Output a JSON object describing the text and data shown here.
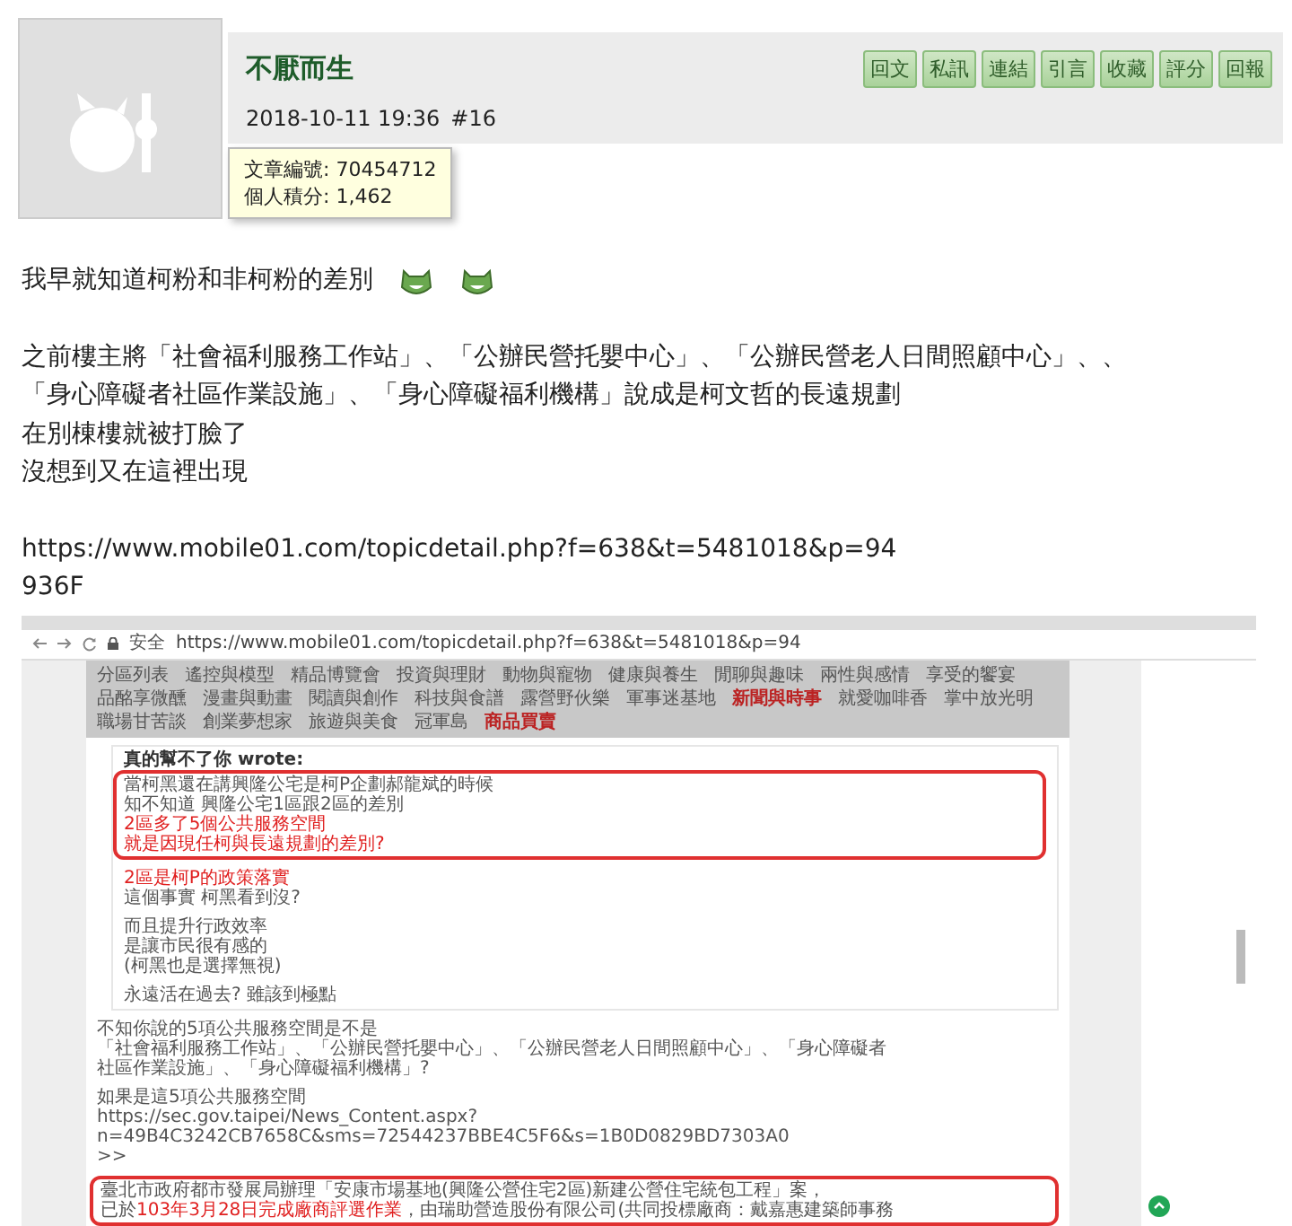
{
  "post": {
    "author": "不厭而生",
    "date": "2018-10-11 19:36",
    "floor": "#16",
    "buttons": [
      "回文",
      "私訊",
      "連結",
      "引言",
      "收藏",
      "評分",
      "回報"
    ],
    "tooltip": [
      {
        "label": "文章編號:",
        "value": "70454712"
      },
      {
        "label": "個人積分:",
        "value": "1,462"
      }
    ]
  },
  "body": [
    {
      "kind": "text",
      "lines": [
        "我早就知道柯粉和非柯粉的差別"
      ],
      "emoticons": true
    },
    {
      "kind": "text",
      "lines": [
        "之前樓主將「社會福利服務工作站」、「公辦民營托嬰中心」、「公辦民營老人日間照顧中心」、、",
        "「身心障礙者社區作業設施」、「身心障礙福利機構」說成是柯文哲的長遠規劃",
        "在別棟樓就被打臉了",
        "沒想到又在這裡出現"
      ],
      "emoticons": false
    },
    {
      "kind": "text",
      "lines": [
        "https://www.mobile01.com/topicdetail.php?f=638&t=5481018&p=94",
        "936F"
      ],
      "emoticons": false
    }
  ],
  "screenshot": {
    "secure_label": "安全",
    "url": "https://www.mobile01.com/topicdetail.php?f=638&t=5481018&p=94",
    "nav_items": [
      {
        "label": "分區列表",
        "highlighted": false
      },
      {
        "label": "遙控與模型",
        "highlighted": false
      },
      {
        "label": "精品博覽會",
        "highlighted": false
      },
      {
        "label": "投資與理財",
        "highlighted": false
      },
      {
        "label": "動物與寵物",
        "highlighted": false
      },
      {
        "label": "健康與養生",
        "highlighted": false
      },
      {
        "label": "閒聊與趣味",
        "highlighted": false
      },
      {
        "label": "兩性與感情",
        "highlighted": false
      },
      {
        "label": "享受的饗宴",
        "highlighted": false
      },
      {
        "label": "品酩享微醺",
        "highlighted": false
      },
      {
        "label": "漫畫與動畫",
        "highlighted": false
      },
      {
        "label": "閱讀與創作",
        "highlighted": false
      },
      {
        "label": "科技與食譜",
        "highlighted": false
      },
      {
        "label": "露營野伙樂",
        "highlighted": false
      },
      {
        "label": "軍事迷基地",
        "highlighted": false
      },
      {
        "label": "新聞與時事",
        "highlighted": true
      },
      {
        "label": "就愛咖啡香",
        "highlighted": false
      },
      {
        "label": "掌中放光明",
        "highlighted": false
      },
      {
        "label": "職場甘苦談",
        "highlighted": false
      },
      {
        "label": "創業夢想家",
        "highlighted": false
      },
      {
        "label": "旅遊與美食",
        "highlighted": false
      },
      {
        "label": "冠軍島",
        "highlighted": false
      },
      {
        "label": "商品買賣",
        "highlighted": true
      }
    ],
    "quote": {
      "heading": "真的幫不了你 wrote:",
      "blocks": [
        {
          "boxed": true,
          "lines": [
            [
              {
                "text": "當柯黑還在講興隆公宅是柯P企劃郝龍斌的時候",
                "red": false
              }
            ],
            [
              {
                "text": "知不知道 興隆公宅1區跟2區的差別",
                "red": false
              }
            ],
            [
              {
                "text": "2區多了5個公共服務空間",
                "red": true
              }
            ],
            [
              {
                "text": "就是因現任柯與長遠規劃的差別?",
                "red": true
              }
            ]
          ]
        },
        {
          "boxed": false,
          "lines": [
            [
              {
                "text": "2區是柯P的政策落實",
                "red": true
              }
            ],
            [
              {
                "text": "這個事實 柯黑看到沒?",
                "red": false
              }
            ]
          ]
        },
        {
          "boxed": false,
          "lines": [
            [
              {
                "text": "而且提升行政效率",
                "red": false
              }
            ],
            [
              {
                "text": "是讓市民很有感的",
                "red": false
              }
            ],
            [
              {
                "text": "(柯黑也是選擇無視)",
                "red": false
              }
            ]
          ]
        },
        {
          "boxed": false,
          "lines": [
            [
              {
                "text": "永遠活在過去? 雖該到極點",
                "red": false
              }
            ]
          ]
        }
      ]
    },
    "reply": [
      {
        "boxed": false,
        "lines": [
          [
            {
              "text": "不知你說的5項公共服務空間是不是",
              "red": false
            }
          ],
          [
            {
              "text": "「社會福利服務工作站」、「公辦民營托嬰中心」、「公辦民營老人日間照顧中心」、「身心障礙者",
              "red": false
            }
          ],
          [
            {
              "text": "社區作業設施」、「身心障礙福利機構」?",
              "red": false
            }
          ]
        ]
      },
      {
        "boxed": false,
        "lines": [
          [
            {
              "text": "如果是這5項公共服務空間",
              "red": false
            }
          ],
          [
            {
              "text": "https://sec.gov.taipei/News_Content.aspx?",
              "red": false
            }
          ],
          [
            {
              "text": "n=49B4C3242CB7658C&sms=72544237BBE4C5F6&s=1B0D0829BD7303A0",
              "red": false
            }
          ],
          [
            {
              "text": ">>",
              "red": false
            }
          ]
        ]
      },
      {
        "boxed": true,
        "lines": [
          [
            {
              "text": "臺北市政府都市發展局辦理「安康市場基地(興隆公營住宅2區)新建公營住宅統包工程」案，",
              "red": false
            }
          ],
          [
            {
              "text": "已於",
              "red": false
            },
            {
              "text": "103年3月28日完成廠商評選作業",
              "red": true
            },
            {
              "text": "，由瑞助營造股份有限公司(共同投標廠商：戴嘉惠建築師事務",
              "red": false
            }
          ]
        ]
      }
    ]
  }
}
